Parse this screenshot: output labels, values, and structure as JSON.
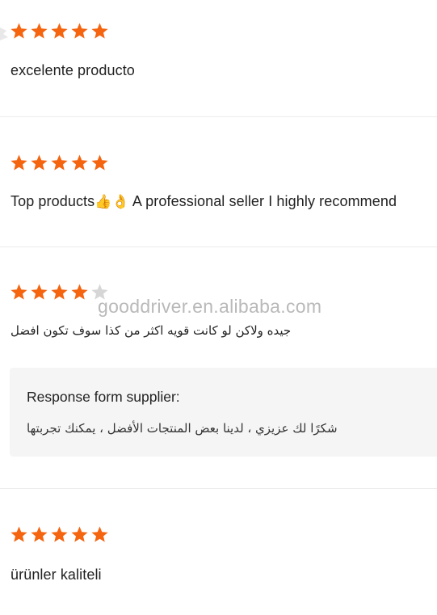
{
  "reviews": [
    {
      "rating": 5,
      "text": "excelente producto"
    },
    {
      "rating": 5,
      "text": "Top products",
      "emojis": [
        "👍",
        "👌"
      ],
      "text_after": " A professional seller I highly recommend"
    },
    {
      "rating": 4,
      "text": "جيده ولاكن لو كانت قويه اكثر من كذا سوف تكون افضل",
      "response": {
        "title": "Response form supplier:",
        "text": "شكرًا لك عزيزي ، لدينا بعض المنتجات الأفضل ، يمكنك تجربتها"
      }
    },
    {
      "rating": 5,
      "text": "ürünler kaliteli"
    }
  ],
  "watermark": "gooddriver.en.alibaba.com",
  "colors": {
    "star_filled": "#f5640f",
    "star_empty": "#d6d6d6",
    "divider": "#ececec",
    "response_bg": "#f5f5f5"
  }
}
